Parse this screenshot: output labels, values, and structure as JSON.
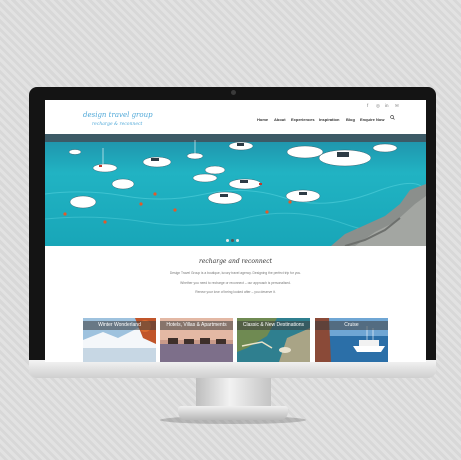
{
  "site": {
    "logo_title": "design travel group",
    "logo_sub": "recharge & reconnect"
  },
  "social": [
    {
      "icon": "facebook-icon",
      "glyph": "f"
    },
    {
      "icon": "instagram-icon",
      "glyph": "◎"
    },
    {
      "icon": "linkedin-icon",
      "glyph": "in"
    },
    {
      "icon": "email-icon",
      "glyph": "✉"
    }
  ],
  "nav": [
    "Home",
    "About",
    "Experiences",
    "Inspiration",
    "Blog",
    "Enquire Now"
  ],
  "hero": {
    "slides": 3,
    "active_slide": 1
  },
  "intro": {
    "tagline": "recharge and reconnect",
    "lines": [
      "Design Travel Group is a boutique, luxury travel agency. Designing the perfect trip for you.",
      "Whether you need to recharge or reconnect – our approach is personalised.",
      "Renew your love of being looked after – you deserve it."
    ]
  },
  "cards": [
    {
      "label": "Winter Wonderland"
    },
    {
      "label": "Hotels, Villas & Apartments"
    },
    {
      "label": "Classic & New Destinations"
    },
    {
      "label": "Cruise"
    }
  ],
  "colors": {
    "brand": "#4fa8d8",
    "sea": "#1fb0c0",
    "bezel": "#141414"
  }
}
